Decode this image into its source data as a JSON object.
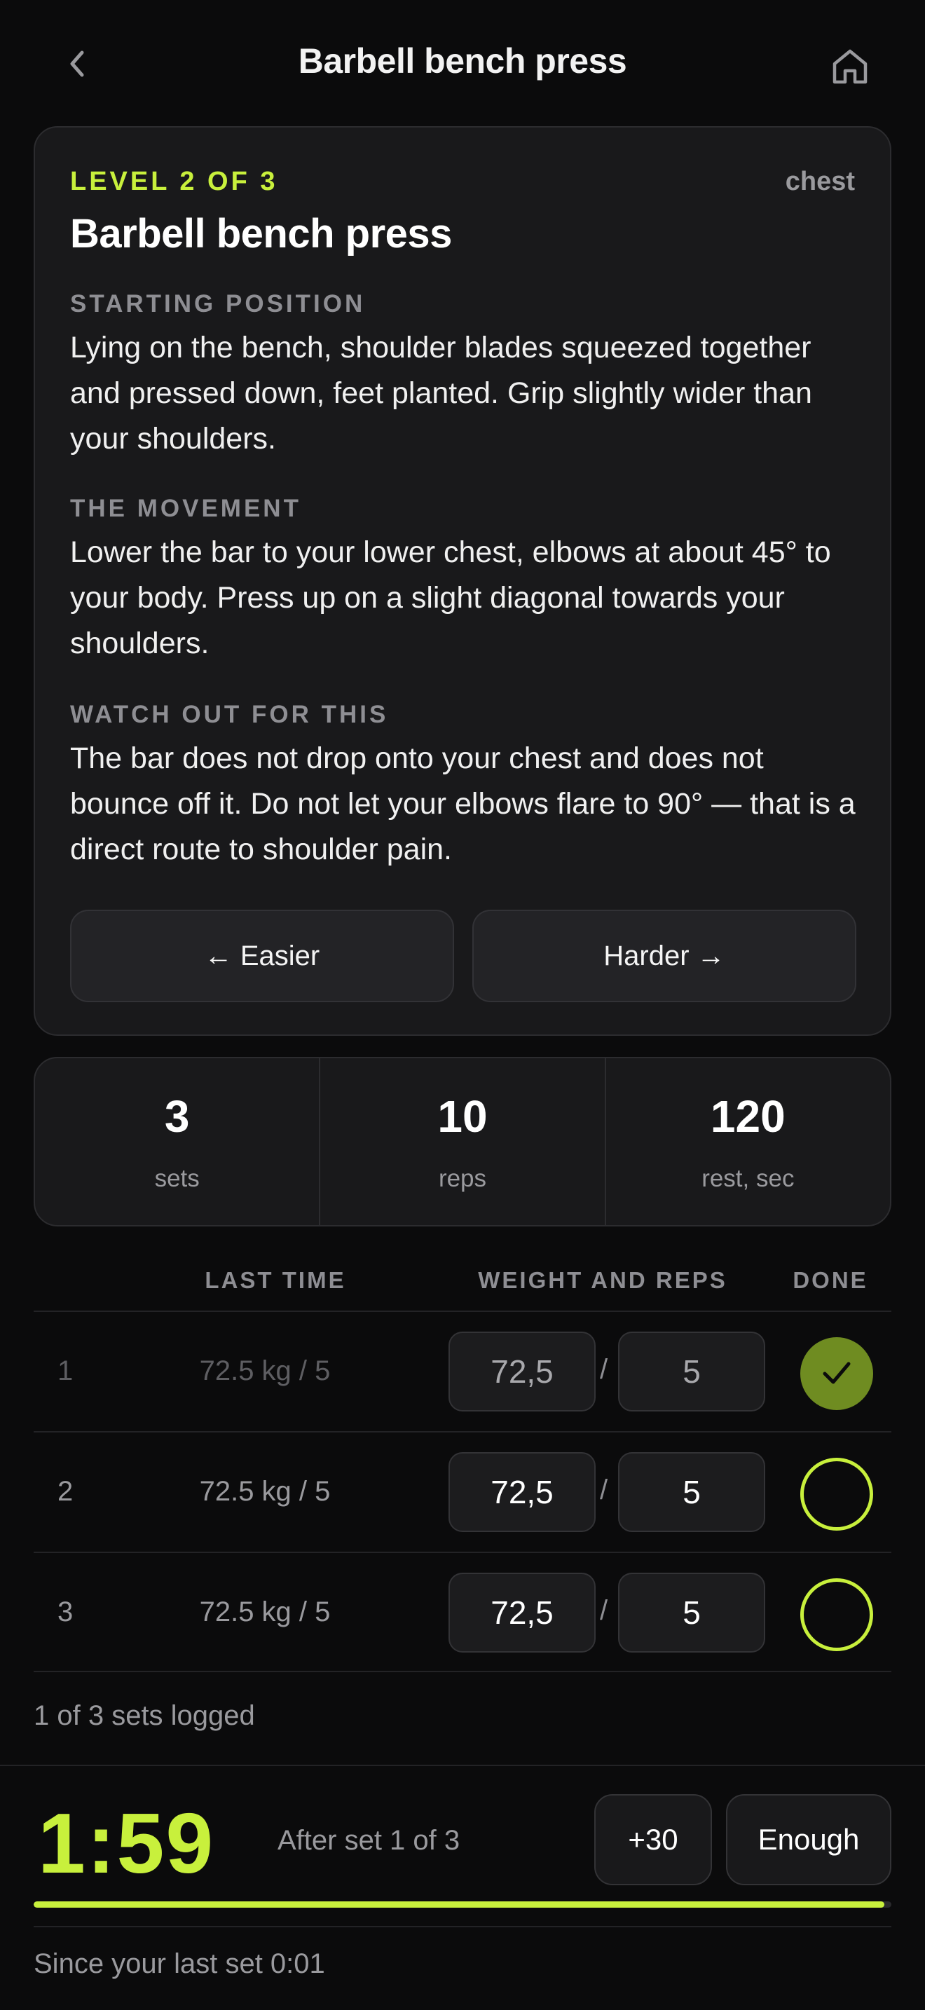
{
  "header": {
    "title": "Barbell bench press",
    "back_icon": "chevron-left-icon",
    "home_icon": "home-icon"
  },
  "exercise": {
    "level": "LEVEL 2 OF 3",
    "muscle": "chest",
    "name": "Barbell bench press",
    "sections": [
      {
        "label": "STARTING POSITION",
        "text": "Lying on the bench, shoulder blades squeezed together and pressed down, feet planted. Grip slightly wider than your shoulders."
      },
      {
        "label": "THE MOVEMENT",
        "text": "Lower the bar to your lower chest, elbows at about 45° to your body. Press up on a slight diagonal towards your shoulders."
      },
      {
        "label": "WATCH OUT FOR THIS",
        "text": "The bar does not drop onto your chest and does not bounce off it. Do not let your elbows flare to 90° — that is a direct route to shoulder pain."
      }
    ],
    "easier_label": "← Easier",
    "harder_label": "Harder →"
  },
  "stats": [
    {
      "value": "3",
      "label": "sets"
    },
    {
      "value": "10",
      "label": "reps"
    },
    {
      "value": "120",
      "label": "rest, sec"
    }
  ],
  "table": {
    "headers": {
      "last_time": "LAST TIME",
      "weight_reps": "WEIGHT AND REPS",
      "done": "DONE"
    },
    "rows": [
      {
        "num": "1",
        "last": "72.5 kg / 5",
        "weight": "72,5",
        "sep": "/",
        "reps": "5",
        "done": true
      },
      {
        "num": "2",
        "last": "72.5 kg / 5",
        "weight": "72,5",
        "sep": "/",
        "reps": "5",
        "done": false
      },
      {
        "num": "3",
        "last": "72.5 kg / 5",
        "weight": "72,5",
        "sep": "/",
        "reps": "5",
        "done": false
      }
    ],
    "logged": "1 of 3 sets logged"
  },
  "timer": {
    "time": "1:59",
    "subtitle": "After set 1 of 3",
    "add_label": "+30",
    "enough_label": "Enough",
    "progress": 0.992,
    "since": "Since your last set 0:01"
  },
  "colors": {
    "accent": "#c8f03c",
    "done_fill": "#6f8c21",
    "background": "#0b0b0c",
    "card": "#19191b"
  }
}
